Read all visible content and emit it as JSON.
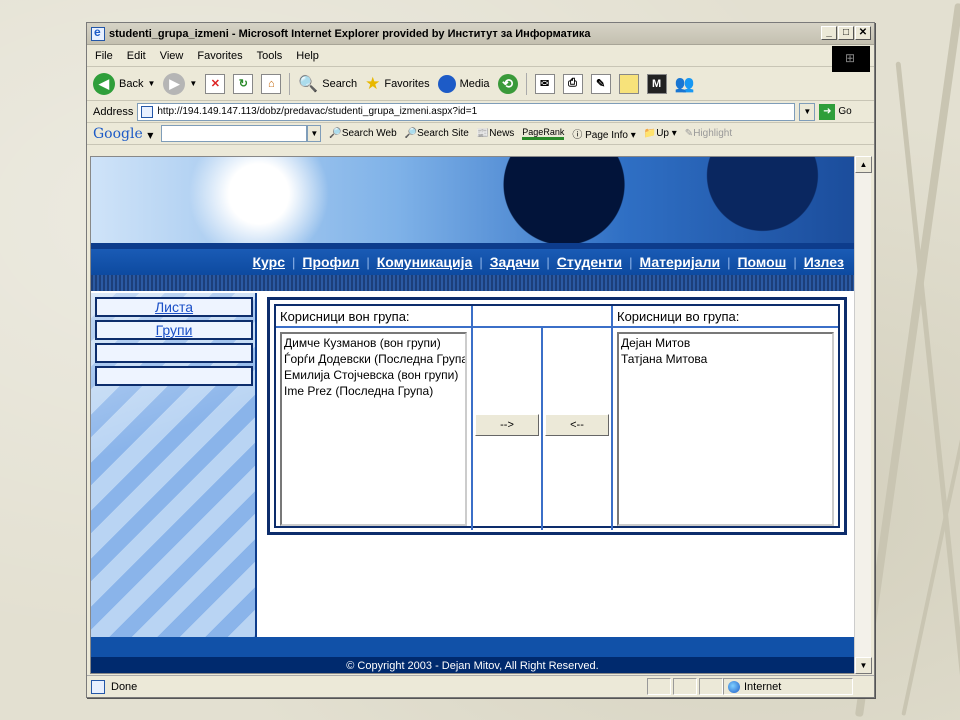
{
  "window": {
    "title": "studenti_grupa_izmeni - Microsoft Internet Explorer provided by Институт за Информатика",
    "minimize": "_",
    "maximize": "□",
    "close": "✕"
  },
  "menubar": [
    "File",
    "Edit",
    "View",
    "Favorites",
    "Tools",
    "Help"
  ],
  "toolbar": {
    "back": "Back",
    "search": "Search",
    "favorites": "Favorites",
    "media": "Media"
  },
  "address": {
    "label": "Address",
    "url": "http://194.149.147.113/dobz/predavac/studenti_grupa_izmeni.aspx?id=1",
    "go": "Go"
  },
  "googlebar": {
    "logo": "Google",
    "search_web": "Search Web",
    "search_site": "Search Site",
    "news": "News",
    "pagerank": "PageRank",
    "page_info": "Page Info",
    "up": "Up",
    "highlight": "Highlight"
  },
  "nav": [
    "Курс",
    "Профил",
    "Комуникација",
    "Задачи",
    "Студенти",
    "Материјали",
    "Помош",
    "Излез"
  ],
  "sidebar": [
    "Листа",
    "Групи",
    "",
    ""
  ],
  "groups": {
    "outside_header": "Корисници вон група:",
    "inside_header": "Корисници во група:",
    "outside_users": [
      "Димче Кузманов (вон групи)",
      "Ѓорѓи Додевски (Последна Група)",
      "Емилија Стојчевска (вон групи)",
      "Ime Prez (Последна Група)"
    ],
    "inside_users": [
      "Дејан Митов",
      "Татјана Митова"
    ],
    "add_button": "-->",
    "remove_button": "<--"
  },
  "footer": "© Copyright 2003 - Dejan Mitov, All Right Reserved.",
  "status": {
    "text": "Done",
    "zone": "Internet"
  }
}
